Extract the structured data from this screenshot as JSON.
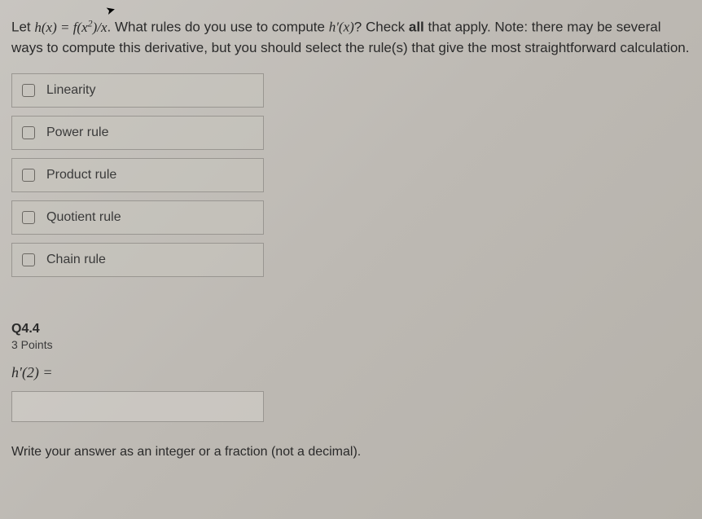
{
  "question": {
    "prefix": "Let ",
    "equation_lhs": "h(x) = f(x",
    "equation_sup": "2",
    "equation_rhs": ")/x",
    "mid1": ". What rules do you use to compute ",
    "hprime": "h′(x)",
    "mid2": "? Check ",
    "all": "all",
    "mid3": " that apply. Note: there may be several ways to compute this derivative, but you should select the rule(s) that give the most straightforward calculation."
  },
  "options": [
    {
      "label": "Linearity"
    },
    {
      "label": "Power rule"
    },
    {
      "label": "Product rule"
    },
    {
      "label": "Quotient rule"
    },
    {
      "label": "Chain rule"
    }
  ],
  "subquestion": {
    "number": "Q4.4",
    "points": "3 Points",
    "formula": "h′(2) =",
    "answer_value": "",
    "instruction": "Write your answer as an integer or a fraction (not a decimal)."
  }
}
